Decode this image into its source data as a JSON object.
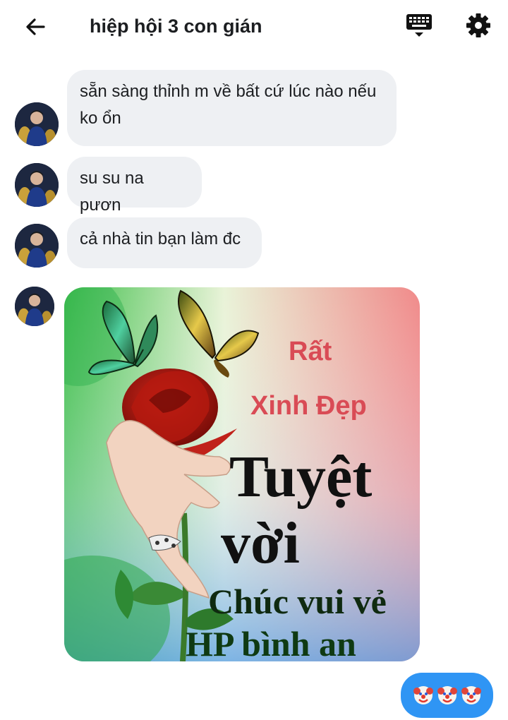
{
  "header": {
    "title": "hiệp hội 3 con gián",
    "back_icon": "arrow-left-icon",
    "keyboard_icon": "keyboard-icon",
    "settings_icon": "gear-icon"
  },
  "messages": [
    {
      "text": "sẵn sàng thỉnh m về bất cứ lúc nào nếu ko ổn"
    },
    {
      "text": "su su na pươn"
    },
    {
      "text": "cả nhà tin bạn làm đc"
    }
  ],
  "image_message": {
    "line1": "Rất",
    "line2": "Xinh Đẹp",
    "line3": "Tuyệt",
    "line4": "vời",
    "line5": "Chúc vui vẻ",
    "line6": "HP bình an"
  },
  "sent_message": {
    "emoji": "clown-face-icon",
    "count": 3
  },
  "colors": {
    "bubble_received": "#eef0f3",
    "bubble_sent": "#2f95f4",
    "text": "#1c1e21"
  }
}
